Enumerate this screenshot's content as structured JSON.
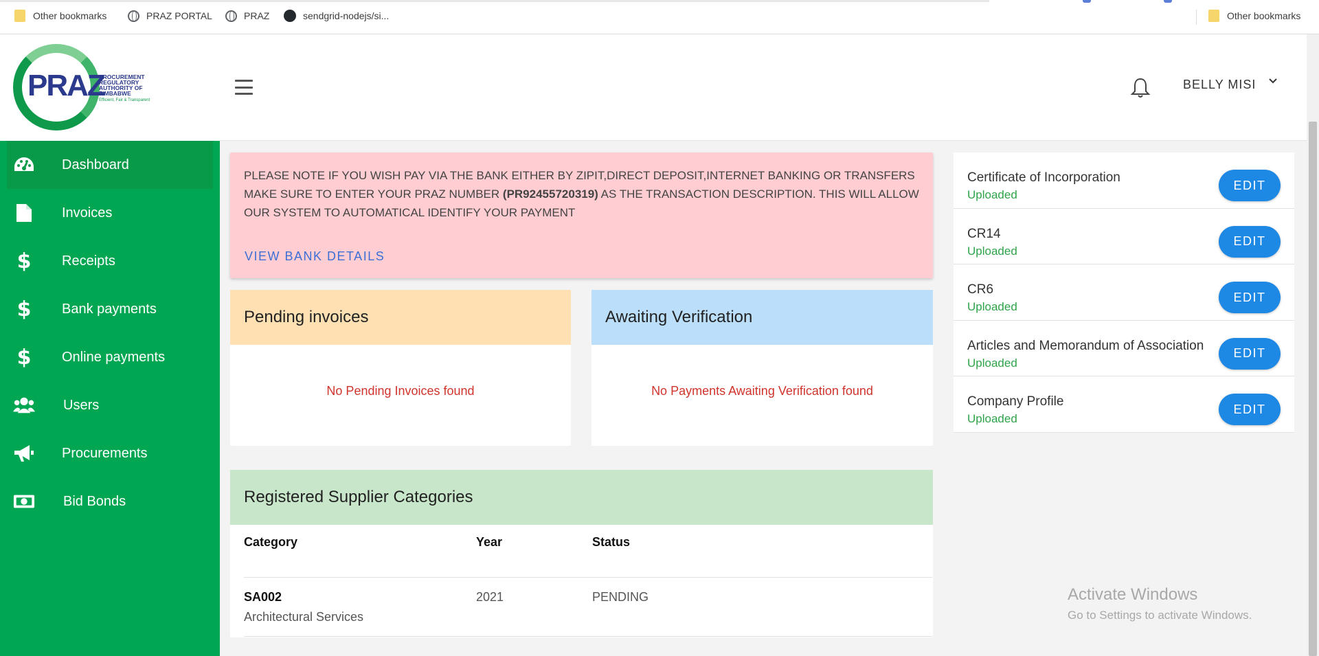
{
  "bookmarks": {
    "items": [
      {
        "label": "Other bookmarks",
        "icon": "folder-icon"
      },
      {
        "label": "PRAZ PORTAL",
        "icon": "globe-icon"
      },
      {
        "label": "PRAZ",
        "icon": "globe-icon"
      },
      {
        "label": "sendgrid-nodejs/si...",
        "icon": "github-icon"
      }
    ],
    "right_label": "Other bookmarks"
  },
  "logo": {
    "text": "PRAZ",
    "subtitle": "PROCUREMENT REGULATORY AUTHORITY OF ZIMBABWE",
    "tagline": "Efficient, Fair & Transparent"
  },
  "sidebar": {
    "items": [
      {
        "label": "Dashboard",
        "icon": "dashboard-gauge-icon",
        "active": true
      },
      {
        "label": "Invoices",
        "icon": "document-icon"
      },
      {
        "label": "Receipts",
        "icon": "dollar-icon"
      },
      {
        "label": "Bank payments",
        "icon": "dollar-icon"
      },
      {
        "label": "Online payments",
        "icon": "dollar-icon"
      },
      {
        "label": "Users",
        "icon": "users-icon"
      },
      {
        "label": "Procurements",
        "icon": "megaphone-icon"
      },
      {
        "label": "Bid Bonds",
        "icon": "money-bill-icon"
      }
    ]
  },
  "header": {
    "user_name": "BELLY MISI"
  },
  "alert": {
    "text_before": "PLEASE NOTE IF YOU WISH PAY VIA THE BANK EITHER BY ZIPIT,DIRECT DEPOSIT,INTERNET BANKING OR TRANSFERS MAKE SURE TO ENTER YOUR PRAZ NUMBER ",
    "praz_number": "(PR92455720319)",
    "text_after": " AS THE TRANSACTION DESCRIPTION. THIS WILL ALLOW OUR SYSTEM TO AUTOMATICAL IDENTIFY YOUR PAYMENT",
    "link": "VIEW BANK DETAILS"
  },
  "pending": {
    "title": "Pending invoices",
    "empty": "No Pending Invoices found"
  },
  "awaiting": {
    "title": "Awaiting Verification",
    "empty": "No Payments Awaiting Verification found"
  },
  "categories": {
    "title": "Registered Supplier Categories",
    "columns": [
      "Category",
      "Year",
      "Status"
    ],
    "rows": [
      {
        "code": "SA002",
        "description": "Architectural Services",
        "year": "2021",
        "status": "PENDING"
      }
    ]
  },
  "documents": {
    "edit_label": "EDIT",
    "items": [
      {
        "name": "Certificate of Incorporation",
        "status": "Uploaded"
      },
      {
        "name": "CR14",
        "status": "Uploaded"
      },
      {
        "name": "CR6",
        "status": "Uploaded"
      },
      {
        "name": "Articles and Memorandum of Association",
        "status": "Uploaded"
      },
      {
        "name": "Company Profile",
        "status": "Uploaded"
      }
    ]
  },
  "watermark": {
    "line1": "Activate Windows",
    "line2": "Go to Settings to activate Windows."
  },
  "colors": {
    "sidebar": "#00a651",
    "alert_bg": "#ffcdd2",
    "pending_bg": "#ffe0b2",
    "awaiting_bg": "#bbdefb",
    "categories_bg": "#c8e6c9",
    "edit_button": "#1e88e5",
    "uploaded_text": "#2fa34a",
    "empty_text": "#d0342c"
  }
}
